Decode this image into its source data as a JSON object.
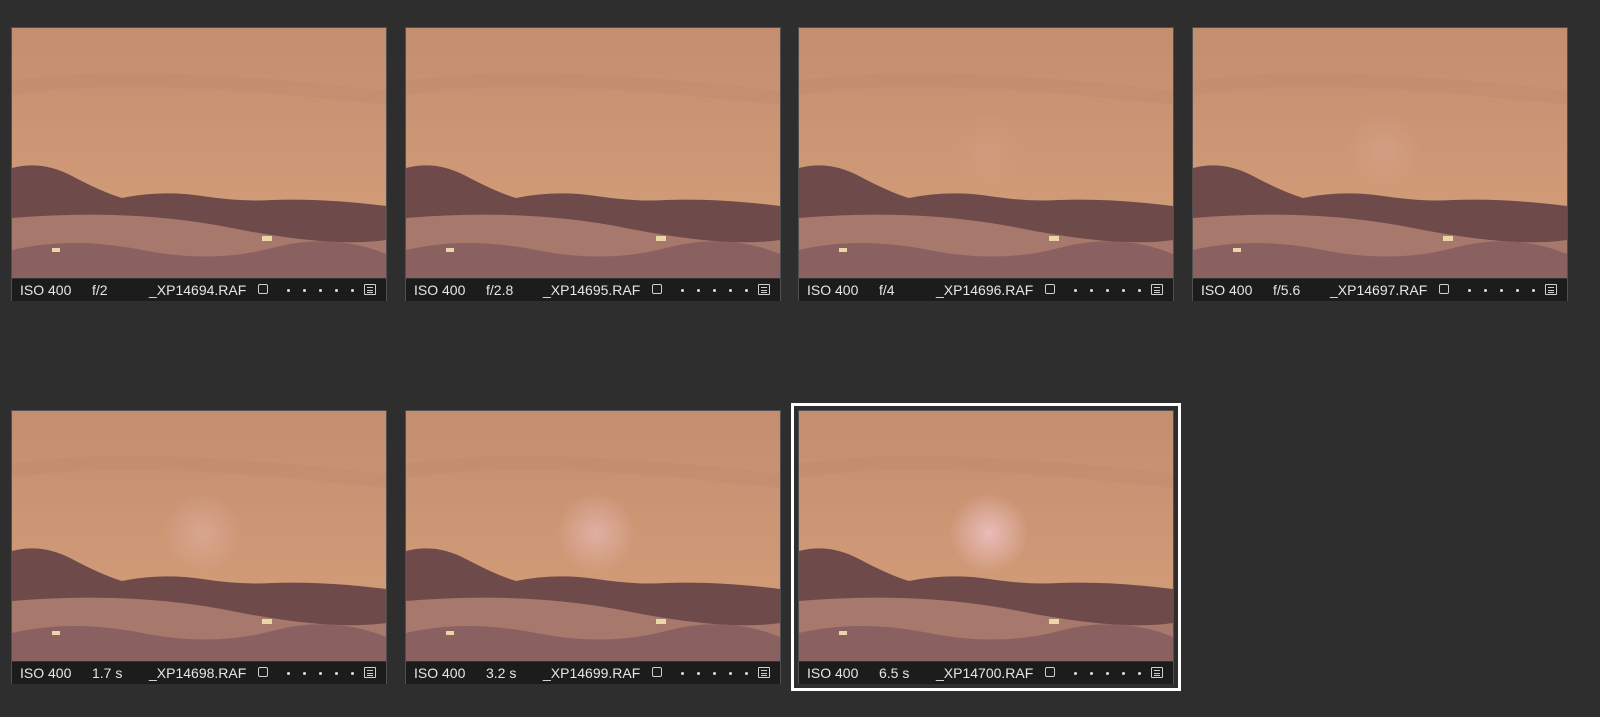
{
  "colors": {
    "background": "#2e2e2e",
    "sky_top": "#c48d70",
    "sky_bottom": "#d6a07a",
    "hills": "#6e4a4a",
    "field": "#a7786c",
    "selection_outline": "#ffffff"
  },
  "thumbnails": [
    {
      "iso": "ISO 400",
      "value": "f/2",
      "filename": "_XP14694.RAF",
      "selected": false,
      "glow": 0
    },
    {
      "iso": "ISO 400",
      "value": "f/2.8",
      "filename": "_XP14695.RAF",
      "selected": false,
      "glow": 0
    },
    {
      "iso": "ISO 400",
      "value": "f/4",
      "filename": "_XP14696.RAF",
      "selected": false,
      "glow": 0.08
    },
    {
      "iso": "ISO 400",
      "value": "f/5.6",
      "filename": "_XP14697.RAF",
      "selected": false,
      "glow": 0.15
    },
    {
      "iso": "ISO 400",
      "value": "1.7 s",
      "filename": "_XP14698.RAF",
      "selected": false,
      "glow": 0.3
    },
    {
      "iso": "ISO 400",
      "value": "3.2 s",
      "filename": "_XP14699.RAF",
      "selected": false,
      "glow": 0.5
    },
    {
      "iso": "ISO 400",
      "value": "6.5 s",
      "filename": "_XP14700.RAF",
      "selected": true,
      "glow": 0.75
    }
  ]
}
